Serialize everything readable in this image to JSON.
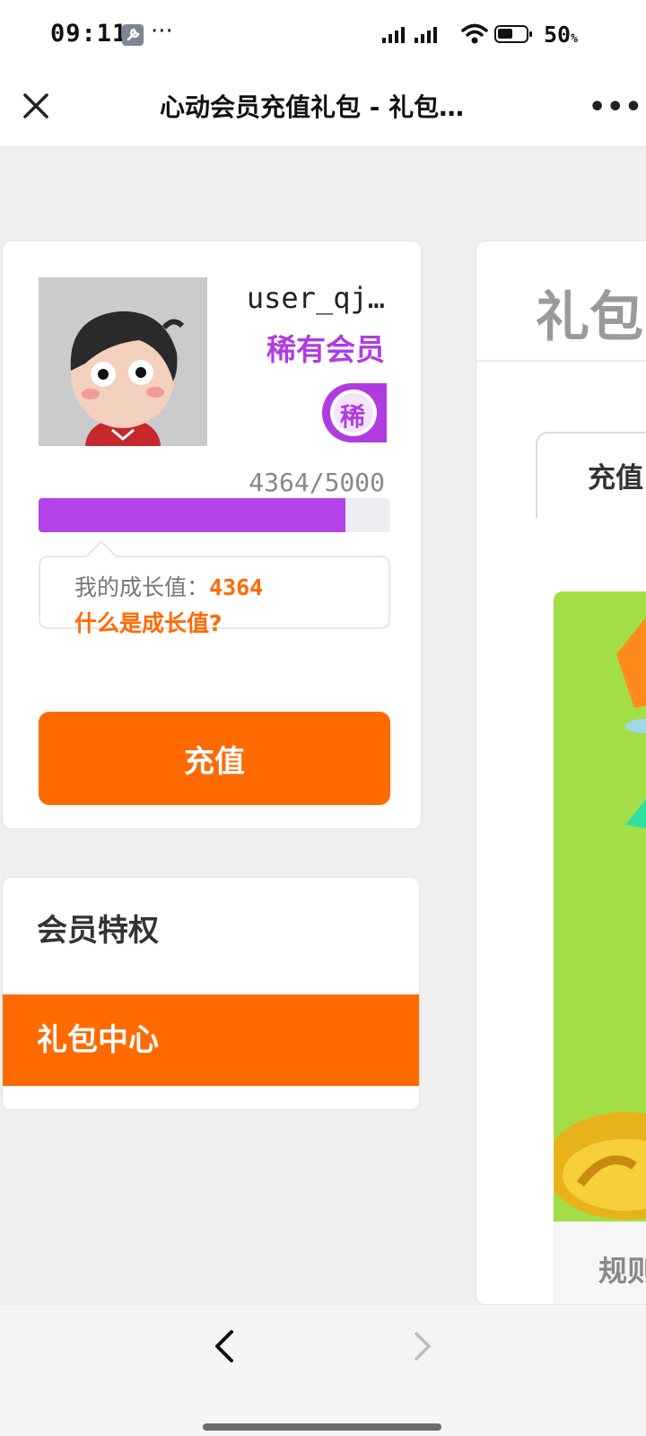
{
  "status_bar": {
    "time": "09:11",
    "extra": "···",
    "battery_percent": "50",
    "battery_unit": "%",
    "battery_level": 0.5,
    "icons": [
      "wrench-icon",
      "signal-icon",
      "wifi-icon",
      "battery-icon"
    ]
  },
  "nav": {
    "title": "心动会员充值礼包 - 礼包…",
    "close_icon": "close-icon",
    "more_label": "•••"
  },
  "profile": {
    "username": "user_qj…",
    "member_level": "稀有会员",
    "badge_char": "稀",
    "growth_text": "4364/5000",
    "growth_current": 4364,
    "growth_max": 5000,
    "tip_label": "我的成长值：",
    "tip_value": "4364",
    "tip_link": "什么是成长值?",
    "recharge_label": "充值"
  },
  "menu": {
    "items": [
      {
        "label": "会员特权",
        "active": false
      },
      {
        "label": "礼包中心",
        "active": true
      }
    ]
  },
  "right_panel": {
    "title": "礼包",
    "tab_label": "充值",
    "rules_label": "规则"
  },
  "colors": {
    "accent_orange": "#ff6a00",
    "member_purple": "#b03ce0",
    "progress_purple": "#b443ea",
    "banner_green": "#a3de46"
  }
}
